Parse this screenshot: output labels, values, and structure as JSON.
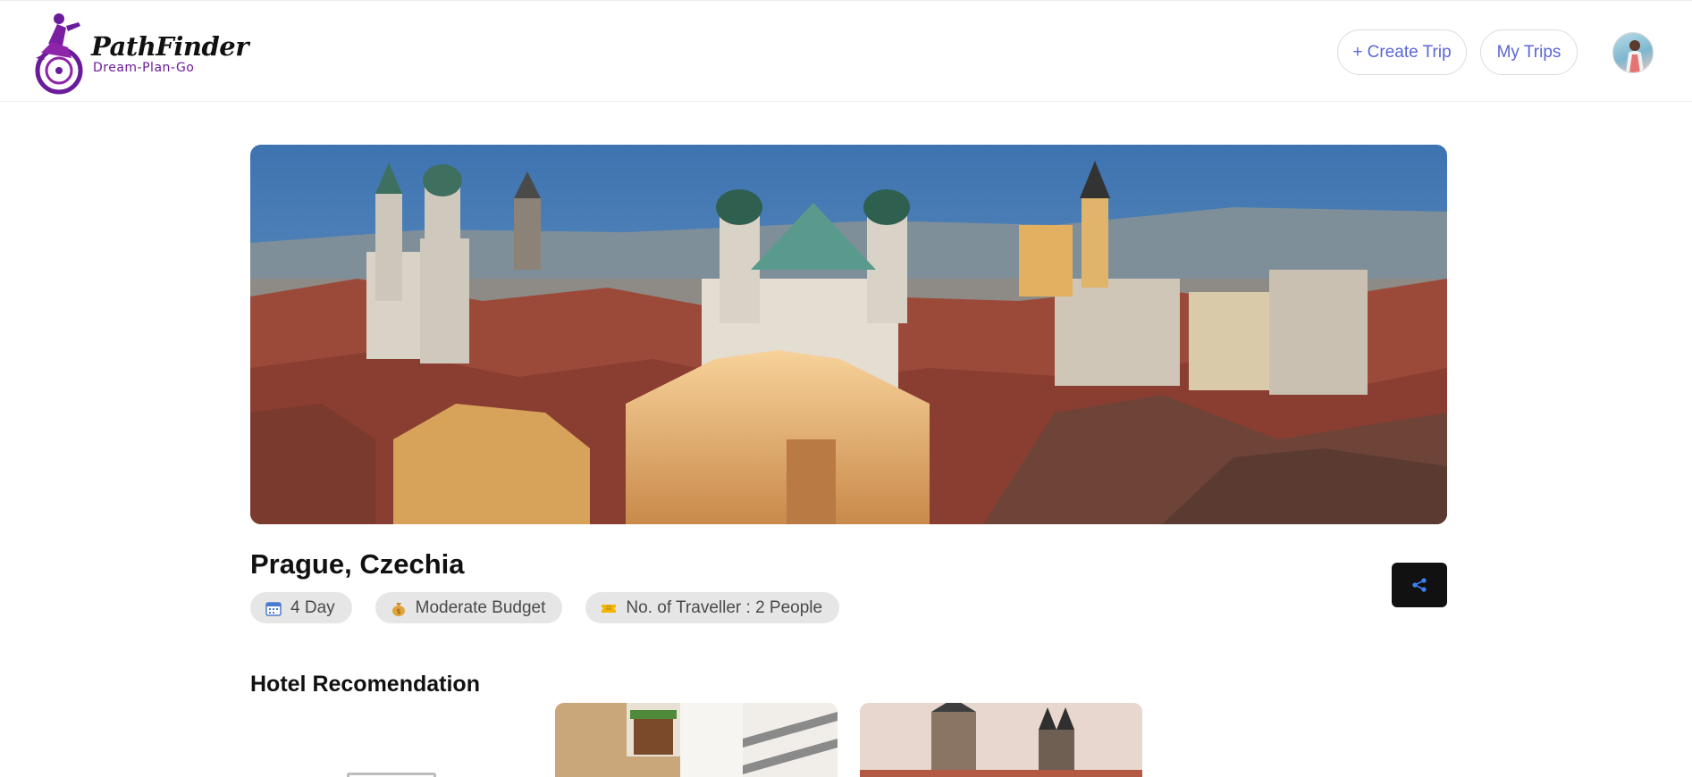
{
  "header": {
    "logo": {
      "title": "PathFinder",
      "tagline": "Dream-Plan-Go"
    },
    "nav": {
      "create_trip": "+ Create Trip",
      "my_trips": "My Trips"
    },
    "avatar": "user-avatar"
  },
  "trip": {
    "location": "Prague, Czechia",
    "chips": [
      {
        "icon": "calendar-icon",
        "label": "4 Day"
      },
      {
        "icon": "money-bag-icon",
        "label": "Moderate Budget"
      },
      {
        "icon": "ticket-icon",
        "label": "No. of Traveller : 2 People"
      }
    ],
    "share_icon": "share-icon"
  },
  "hotels": {
    "title": "Hotel Recomendation"
  },
  "colors": {
    "accent": "#5b66d6",
    "brand": "#6a1b9a",
    "chip_bg": "#e6e6e6",
    "share_bg": "#111111",
    "share_icon": "#3b82f6"
  }
}
